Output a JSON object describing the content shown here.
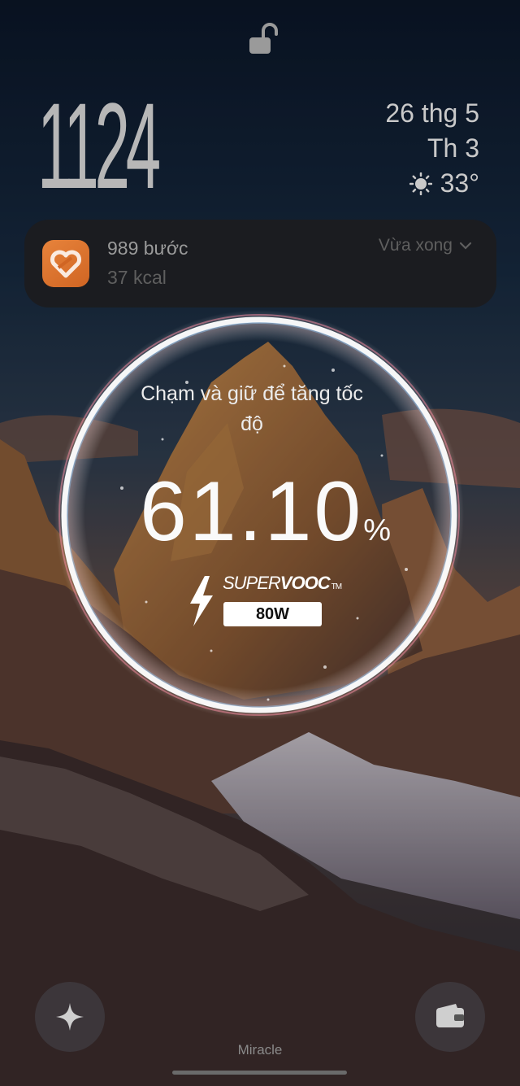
{
  "lockscreen": {
    "clock": "1124",
    "date": "26 thg 5",
    "weekday": "Th 3",
    "weather_icon": "sun-icon",
    "temperature": "33°"
  },
  "notification": {
    "app_icon": "health-app-icon",
    "title": "989 bước",
    "subtitle": "37 kcal",
    "time": "Vừa xong"
  },
  "charging": {
    "hint": "Chạm và giữ để tăng tốc độ",
    "percent_value": "61.10",
    "percent_sign": "%",
    "brand_light": "SUPER",
    "brand_bold": "VOOC",
    "brand_tm": "TM",
    "wattage": "80W"
  },
  "bottom": {
    "left_button_icon": "sparkle-icon",
    "right_button_icon": "wallet-icon",
    "label": "Miracle"
  },
  "colors": {
    "ring": "#ffffff",
    "notification_bg": "#1c1c1e",
    "app_icon_bg": "#e07a34"
  }
}
